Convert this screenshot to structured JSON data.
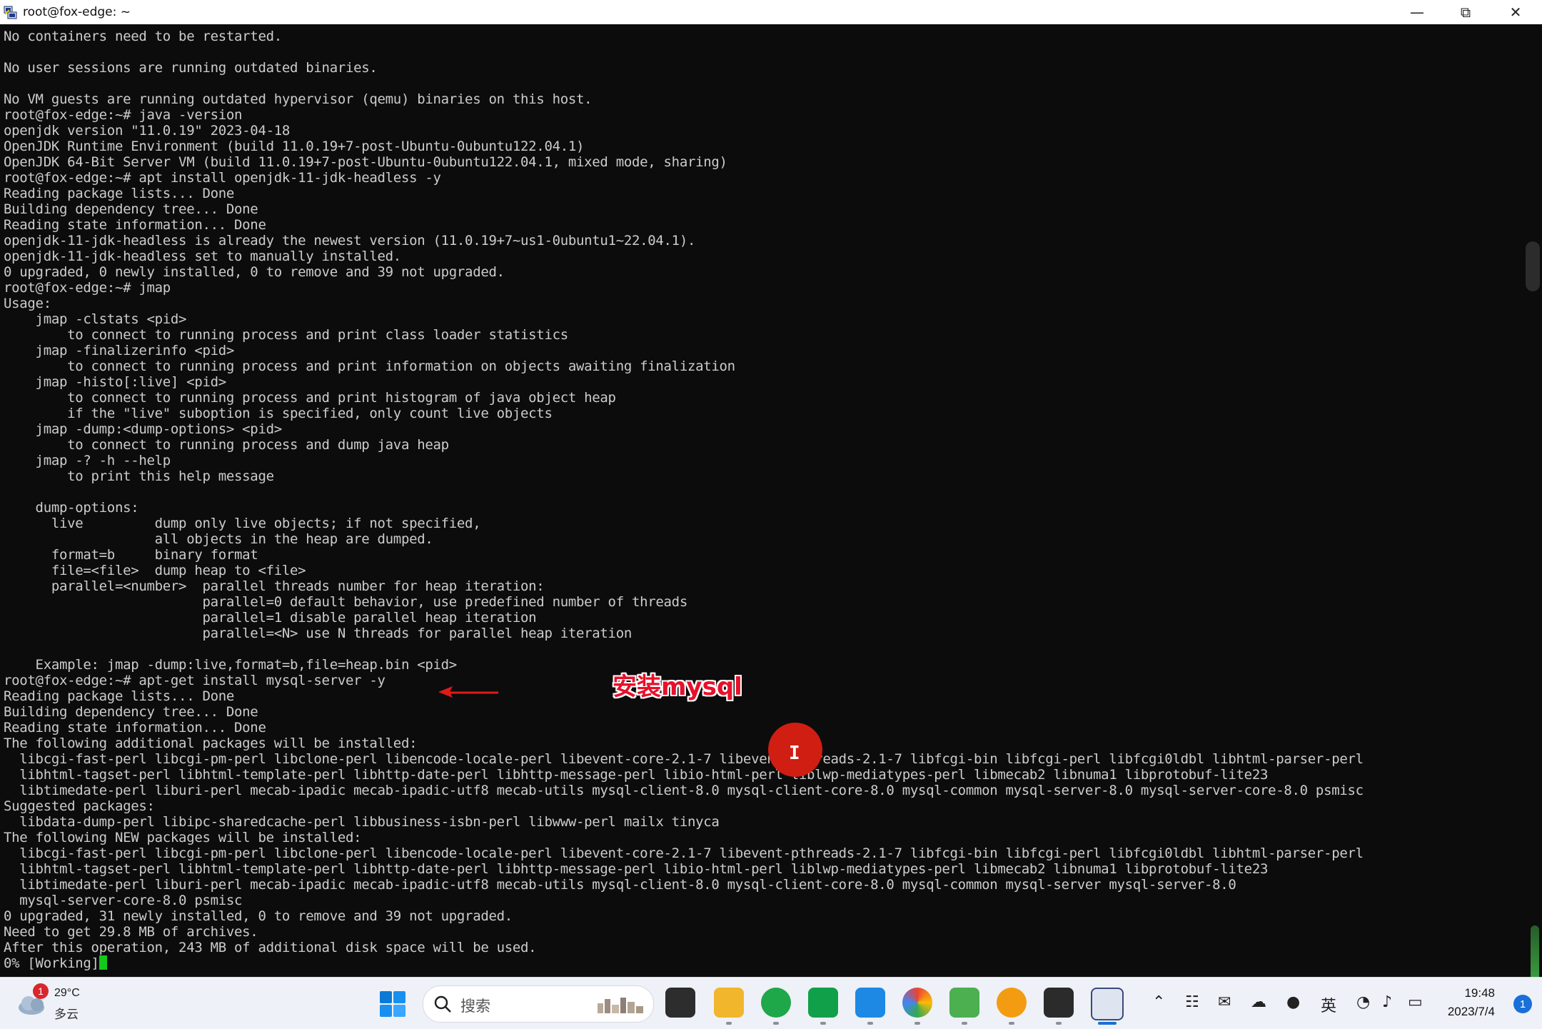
{
  "window": {
    "title": "root@fox-edge: ~",
    "minimize": "—",
    "restore": "⧉",
    "close": "✕"
  },
  "terminal": {
    "lines": [
      "No containers need to be restarted.",
      "",
      "No user sessions are running outdated binaries.",
      "",
      "No VM guests are running outdated hypervisor (qemu) binaries on this host.",
      "root@fox-edge:~# java -version",
      "openjdk version \"11.0.19\" 2023-04-18",
      "OpenJDK Runtime Environment (build 11.0.19+7-post-Ubuntu-0ubuntu122.04.1)",
      "OpenJDK 64-Bit Server VM (build 11.0.19+7-post-Ubuntu-0ubuntu122.04.1, mixed mode, sharing)",
      "root@fox-edge:~# apt install openjdk-11-jdk-headless -y",
      "Reading package lists... Done",
      "Building dependency tree... Done",
      "Reading state information... Done",
      "openjdk-11-jdk-headless is already the newest version (11.0.19+7~us1-0ubuntu1~22.04.1).",
      "openjdk-11-jdk-headless set to manually installed.",
      "0 upgraded, 0 newly installed, 0 to remove and 39 not upgraded.",
      "root@fox-edge:~# jmap",
      "Usage:",
      "    jmap -clstats <pid>",
      "        to connect to running process and print class loader statistics",
      "    jmap -finalizerinfo <pid>",
      "        to connect to running process and print information on objects awaiting finalization",
      "    jmap -histo[:live] <pid>",
      "        to connect to running process and print histogram of java object heap",
      "        if the \"live\" suboption is specified, only count live objects",
      "    jmap -dump:<dump-options> <pid>",
      "        to connect to running process and dump java heap",
      "    jmap -? -h --help",
      "        to print this help message",
      "",
      "    dump-options:",
      "      live         dump only live objects; if not specified,",
      "                   all objects in the heap are dumped.",
      "      format=b     binary format",
      "      file=<file>  dump heap to <file>",
      "      parallel=<number>  parallel threads number for heap iteration:",
      "                         parallel=0 default behavior, use predefined number of threads",
      "                         parallel=1 disable parallel heap iteration",
      "                         parallel=<N> use N threads for parallel heap iteration",
      "",
      "    Example: jmap -dump:live,format=b,file=heap.bin <pid>",
      "root@fox-edge:~# apt-get install mysql-server -y",
      "Reading package lists... Done",
      "Building dependency tree... Done",
      "Reading state information... Done",
      "The following additional packages will be installed:",
      "  libcgi-fast-perl libcgi-pm-perl libclone-perl libencode-locale-perl libevent-core-2.1-7 libevent-pthreads-2.1-7 libfcgi-bin libfcgi-perl libfcgi0ldbl libhtml-parser-perl",
      "  libhtml-tagset-perl libhtml-template-perl libhttp-date-perl libhttp-message-perl libio-html-perl liblwp-mediatypes-perl libmecab2 libnuma1 libprotobuf-lite23",
      "  libtimedate-perl liburi-perl mecab-ipadic mecab-ipadic-utf8 mecab-utils mysql-client-8.0 mysql-client-core-8.0 mysql-common mysql-server-8.0 mysql-server-core-8.0 psmisc",
      "Suggested packages:",
      "  libdata-dump-perl libipc-sharedcache-perl libbusiness-isbn-perl libwww-perl mailx tinyca",
      "The following NEW packages will be installed:",
      "  libcgi-fast-perl libcgi-pm-perl libclone-perl libencode-locale-perl libevent-core-2.1-7 libevent-pthreads-2.1-7 libfcgi-bin libfcgi-perl libfcgi0ldbl libhtml-parser-perl",
      "  libhtml-tagset-perl libhtml-template-perl libhttp-date-perl libhttp-message-perl libio-html-perl liblwp-mediatypes-perl libmecab2 libnuma1 libprotobuf-lite23",
      "  libtimedate-perl liburi-perl mecab-ipadic mecab-ipadic-utf8 mecab-utils mysql-client-8.0 mysql-client-core-8.0 mysql-common mysql-server mysql-server-8.0",
      "  mysql-server-core-8.0 psmisc",
      "0 upgraded, 31 newly installed, 0 to remove and 39 not upgraded.",
      "Need to get 29.8 MB of archives.",
      "After this operation, 243 MB of additional disk space will be used."
    ],
    "last_line": "0% [Working]"
  },
  "annotation": {
    "text": "安装mysql",
    "color": "#e8102a"
  },
  "taskbar": {
    "weather": {
      "badge": "1",
      "temp": "29°C",
      "desc": "多云"
    },
    "search": {
      "placeholder": "搜索"
    },
    "tray": {
      "ime": "英"
    },
    "clock": {
      "time": "19:48",
      "date": "2023/7/4"
    },
    "notifications": "1"
  }
}
